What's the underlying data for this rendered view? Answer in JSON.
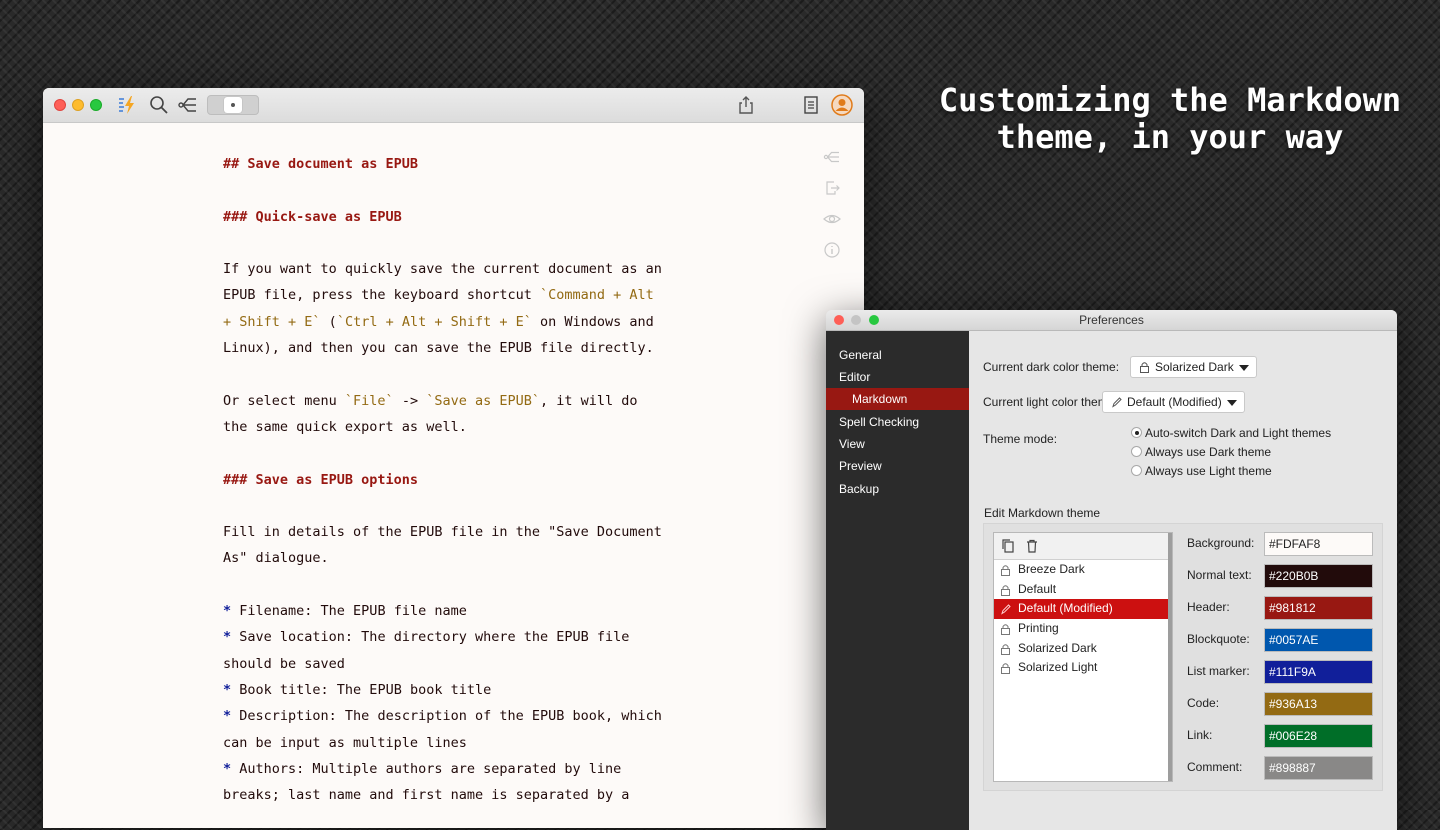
{
  "headline": {
    "line1": "Customizing the Markdown",
    "line2": "theme, in your way"
  },
  "editor": {
    "toolbar_icons": [
      "lightning-icon",
      "search-icon",
      "outline-icon",
      "segmented-control",
      "share-icon",
      "document-icon",
      "avatar-icon"
    ],
    "doc": {
      "h2": "## Save document as EPUB",
      "h3a": "### Quick-save as EPUB",
      "p1_l1": "If you want to quickly save the current document as an",
      "p1_l2a": "EPUB file, press the keyboard shortcut ",
      "p1_l2code": "`Command + Alt",
      "p1_l3code": "+ Shift + E`",
      "p1_l3b": " (",
      "p1_l3code2": "`Ctrl + Alt + Shift + E`",
      "p1_l3c": " on Windows and",
      "p1_l4": "Linux), and then you can save the EPUB file directly.",
      "p2_l1a": "Or select menu ",
      "p2_l1code": "`File`",
      "p2_l1b": " -> ",
      "p2_l1code2": "`Save as EPUB`",
      "p2_l1c": ", it will do",
      "p2_l2": "the same quick export as well.",
      "h3b": "### Save as EPUB options",
      "p3_l1": "Fill in details of the EPUB file in the \"Save Document",
      "p3_l2": "As\" dialogue.",
      "marker": "*",
      "li1": " Filename: The EPUB file name",
      "li2_l1": " Save location: The directory where the EPUB file",
      "li2_l2": "should be saved",
      "li3": " Book title: The EPUB book title",
      "li4_l1": " Description: The description of the EPUB book, which",
      "li4_l2": "can be input as multiple lines",
      "li5_l1": " Authors: Multiple authors are separated by line",
      "li5_l2": "breaks; last name and first name is separated by a"
    }
  },
  "prefs": {
    "title": "Preferences",
    "nav": [
      "General",
      "Editor",
      "Markdown",
      "Spell Checking",
      "View",
      "Preview",
      "Backup"
    ],
    "dark_theme_label": "Current dark color theme:",
    "dark_theme_value": "Solarized Dark",
    "light_theme_label": "Current light color theme:",
    "light_theme_value": "Default (Modified)",
    "theme_mode_label": "Theme mode:",
    "modes": [
      "Auto-switch Dark and Light themes",
      "Always use Dark theme",
      "Always use Light theme"
    ],
    "selected_mode": 0,
    "edit_label": "Edit Markdown theme",
    "themes": [
      "Breeze Dark",
      "Default",
      "Default (Modified)",
      "Printing",
      "Solarized Dark",
      "Solarized Light"
    ],
    "colors": [
      {
        "label": "Background:",
        "value": "#FDFAF8",
        "hex": "#FDFAF8"
      },
      {
        "label": "Normal text:",
        "value": "#220B0B",
        "hex": "#220B0B"
      },
      {
        "label": "Header:",
        "value": "#981812",
        "hex": "#981812"
      },
      {
        "label": "Blockquote:",
        "value": "#0057AE",
        "hex": "#0057AE"
      },
      {
        "label": "List marker:",
        "value": "#111F9A",
        "hex": "#111F9A"
      },
      {
        "label": "Code:",
        "value": "#936A13",
        "hex": "#936A13"
      },
      {
        "label": "Link:",
        "value": "#006E28",
        "hex": "#006E28"
      },
      {
        "label": "Comment:",
        "value": "#898887",
        "hex": "#898887"
      }
    ]
  }
}
